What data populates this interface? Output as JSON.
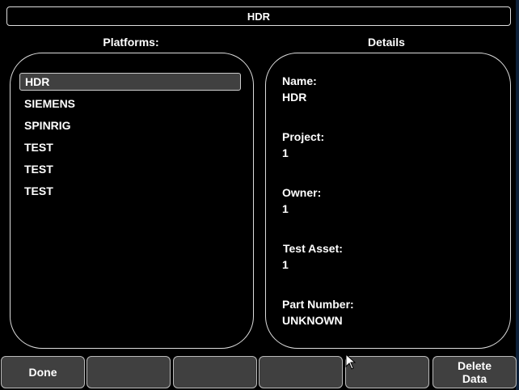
{
  "title": "HDR",
  "platforms": {
    "header": "Platforms:",
    "items": [
      "HDR",
      "SIEMENS",
      "SPINRIG",
      "TEST",
      "TEST",
      "TEST"
    ],
    "selected_index": 0
  },
  "details": {
    "header": "Details",
    "fields": [
      {
        "label": "Name:",
        "value": "HDR"
      },
      {
        "label": "Project:",
        "value": "1"
      },
      {
        "label": "Owner:",
        "value": "1"
      },
      {
        "label": "Test Asset:",
        "value": "1"
      },
      {
        "label": "Part Number:",
        "value": "UNKNOWN"
      }
    ]
  },
  "buttons": {
    "done": "Done",
    "delete_line1": "Delete",
    "delete_line2": "Data"
  }
}
